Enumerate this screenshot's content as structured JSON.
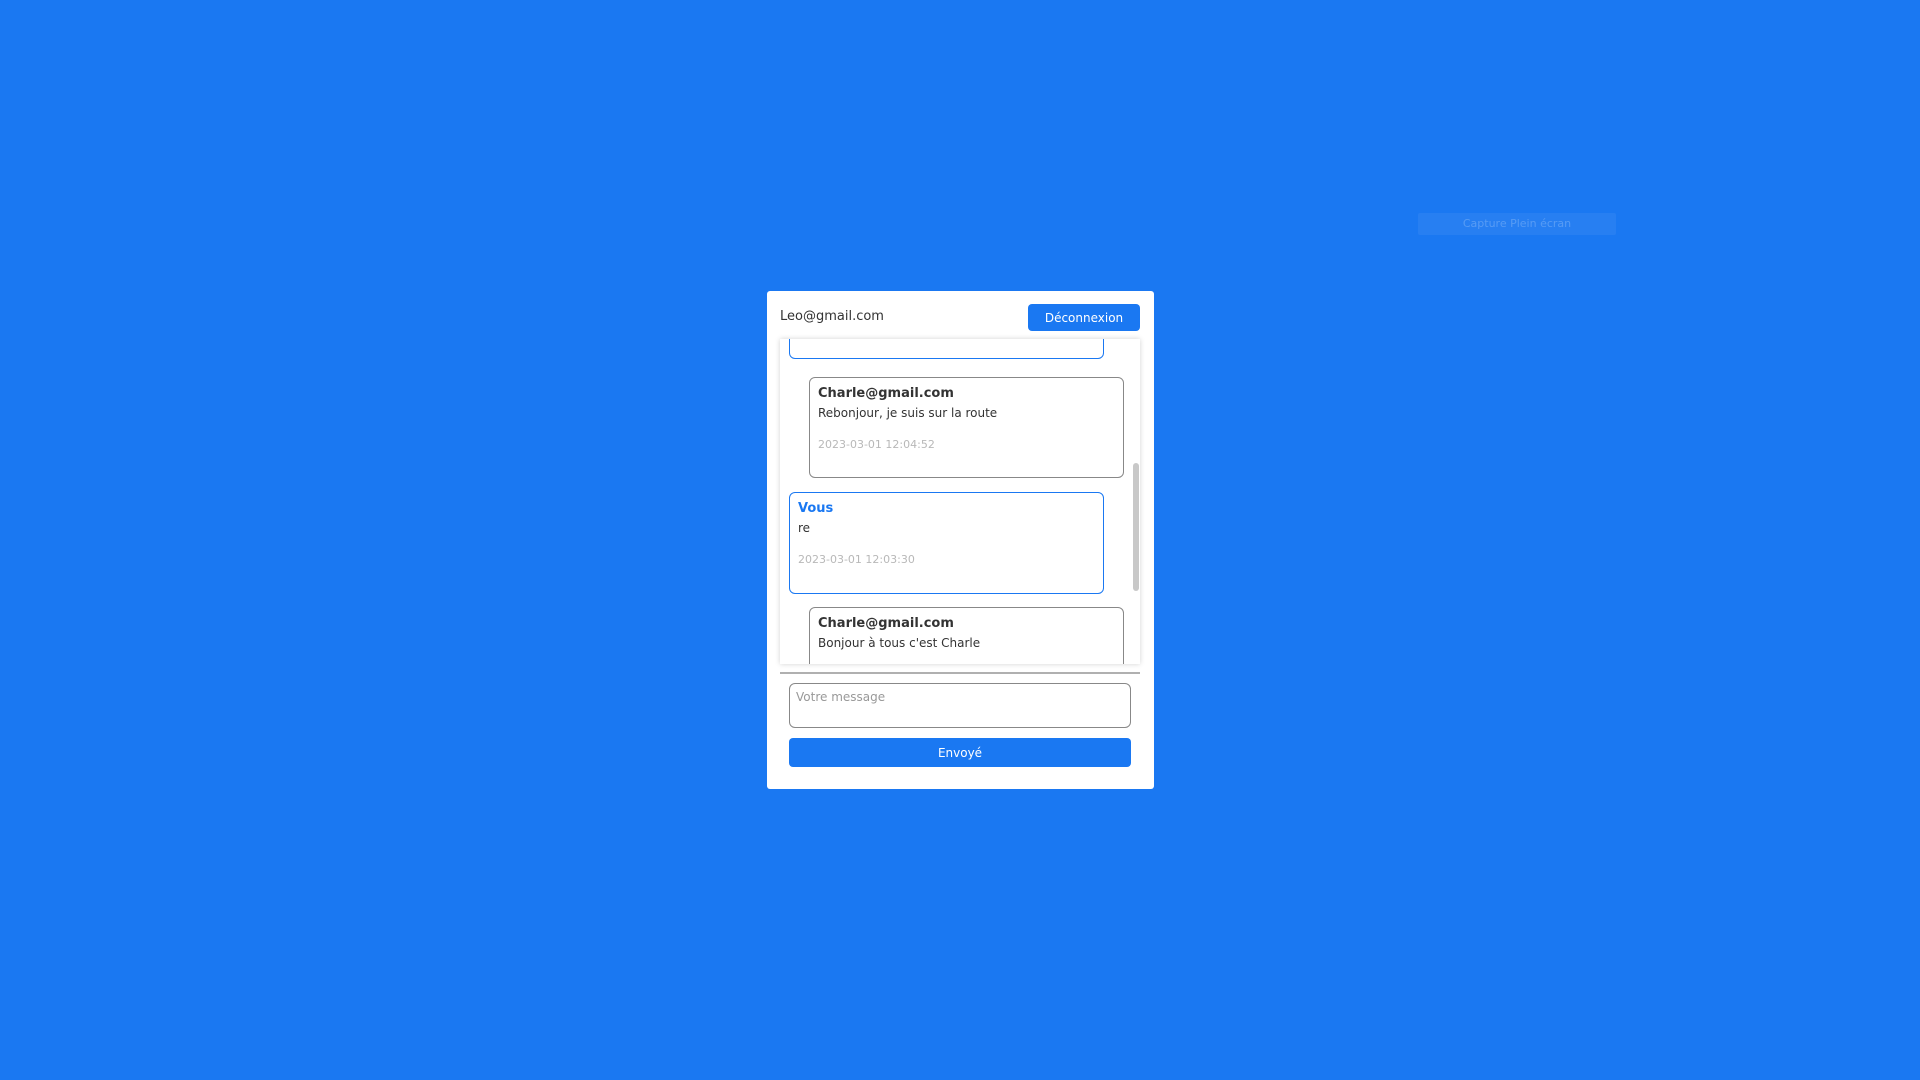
{
  "overlay": {
    "label": "Capture Plein écran"
  },
  "header": {
    "user_email": "Leo@gmail.com",
    "logout_label": "Déconnexion"
  },
  "messages": [
    {
      "author": "",
      "text": "",
      "time": "",
      "mine": true
    },
    {
      "author": "Charle@gmail.com",
      "text": "Rebonjour, je suis sur la route",
      "time": "2023-03-01 12:04:52",
      "mine": false
    },
    {
      "author": "Vous",
      "text": "re",
      "time": "2023-03-01 12:03:30",
      "mine": true
    },
    {
      "author": "Charle@gmail.com",
      "text": "Bonjour à tous c'est Charle",
      "time": "",
      "mine": false
    }
  ],
  "composer": {
    "placeholder": "Votre message",
    "send_label": "Envoyé"
  },
  "colors": {
    "background": "#1a78f2",
    "accent": "#1a78f2",
    "card": "#ffffff"
  }
}
